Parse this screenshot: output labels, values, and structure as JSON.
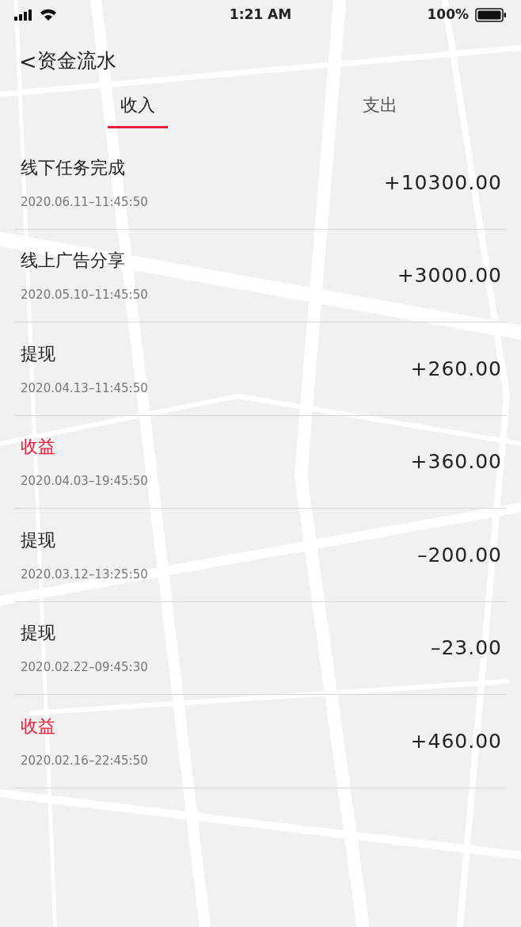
{
  "status_bar": {
    "time": "1:21 AM",
    "battery": "100%"
  },
  "header": {
    "back": "<",
    "title": "资金流水"
  },
  "tabs": [
    {
      "label": "收入",
      "selected": true
    },
    {
      "label": "支出",
      "selected": false
    }
  ],
  "records": [
    {
      "title": "线下任务完成",
      "date": "2020.06.11–11:45:50",
      "amount": "+10300.00",
      "highlighted": false
    },
    {
      "title": "线上广告分享",
      "date": "2020.05.10–11:45:50",
      "amount": "+3000.00",
      "highlighted": false
    },
    {
      "title": "提现",
      "date": "2020.04.13–11:45:50",
      "amount": "+260.00",
      "highlighted": false
    },
    {
      "title": "收益",
      "date": "2020.04.03–19:45:50",
      "amount": "+360.00",
      "highlighted": true
    },
    {
      "title": "提现",
      "date": "2020.03.12–13:25:50",
      "amount": "–200.00",
      "highlighted": false
    },
    {
      "title": "提现",
      "date": "2020.02.22–09:45:30",
      "amount": "–23.00",
      "highlighted": false
    },
    {
      "title": "收益",
      "date": "2020.02.16–22:45:50",
      "amount": "+460.00",
      "highlighted": true
    }
  ]
}
